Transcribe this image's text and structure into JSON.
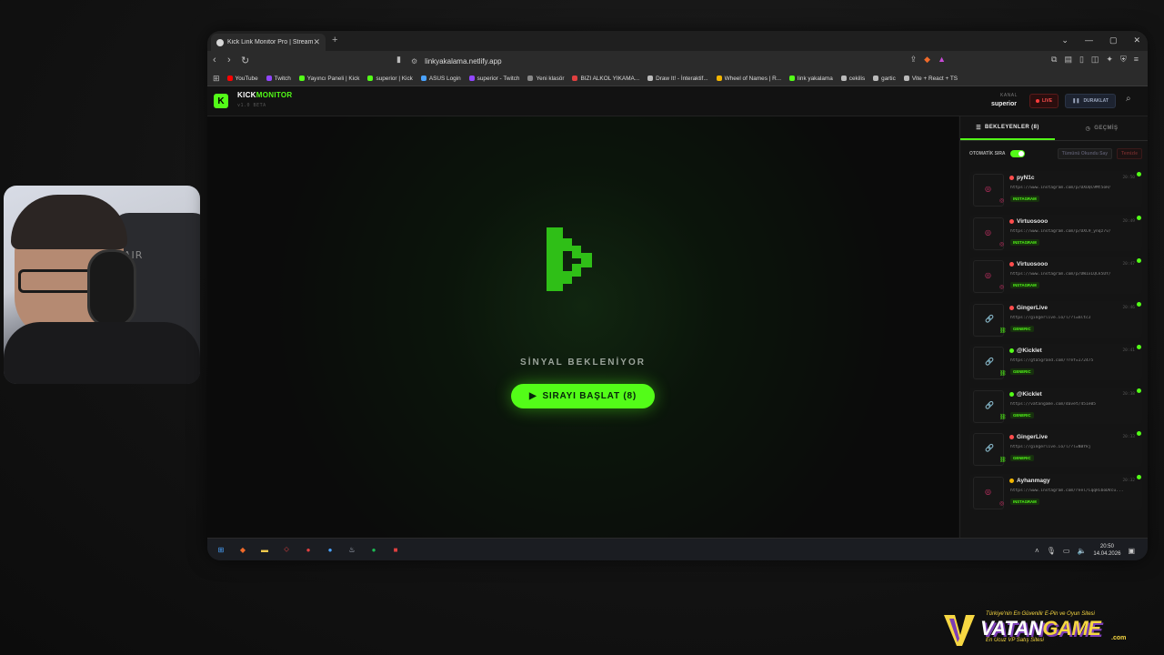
{
  "browser": {
    "tab_title": "Kick Link Monitor Pro | Stream D",
    "url": "linkyakalama.netlify.app",
    "bookmarks": [
      {
        "label": "YouTube",
        "color": "#ff0000"
      },
      {
        "label": "Twitch",
        "color": "#9146ff"
      },
      {
        "label": "Yayıncı Paneli | Kick",
        "color": "#53fc18"
      },
      {
        "label": "superior | Kick",
        "color": "#53fc18"
      },
      {
        "label": "ASUS Login",
        "color": "#4aa3ff"
      },
      {
        "label": "superior - Twitch",
        "color": "#9146ff"
      },
      {
        "label": "Yeni klasör",
        "color": "#888888"
      },
      {
        "label": "BIZI ALKOL YIKAMA...",
        "color": "#e04040"
      },
      {
        "label": "Draw It! - İnteraktif...",
        "color": "#bbbbbb"
      },
      {
        "label": "Wheel of Names | R...",
        "color": "#f2b500"
      },
      {
        "label": "link yakalama",
        "color": "#53fc18"
      },
      {
        "label": "cekilis",
        "color": "#bbbbbb"
      },
      {
        "label": "gartic",
        "color": "#bbbbbb"
      },
      {
        "label": "Vite + React + TS",
        "color": "#bbbbbb"
      }
    ]
  },
  "app": {
    "brand_kick": "KICK",
    "brand_monitor": "MONITOR",
    "logo_letter": "K",
    "version": "v1.0 BETA",
    "channel_label": "KANAL",
    "channel_name": "superior",
    "live_label": "LIVE",
    "pause_label": "DURAKLAT",
    "signal_text": "SİNYAL BEKLENİYOR",
    "start_button": "SIRAYI BAŞLAT (8)",
    "accent_color": "#53fc18"
  },
  "sidebar": {
    "tab_waiting": "BEKLEYENLER (8)",
    "tab_history": "GEÇMİŞ",
    "auto_queue_label": "OTOMATİK SIRA",
    "mark_all_read": "Tümünü Okundu Say",
    "clear": "Temizle",
    "items": [
      {
        "name": "pyN1c",
        "time": "20:50",
        "url": "https://www.instagram.com/p/DXOQC9Mt5oH/",
        "tag": "INSTAGRAM",
        "dot": "#ff4d4d",
        "icon": "instagram"
      },
      {
        "name": "Virtuosooo",
        "time": "20:49",
        "url": "https://www.instagram.com/p/DXC9_ynqz7v/",
        "tag": "INSTAGRAM",
        "dot": "#ff4d4d",
        "icon": "instagram"
      },
      {
        "name": "Virtuosooo",
        "time": "20:47",
        "url": "https://www.instagram.com/p/DW1xLQCk5UY/",
        "tag": "INSTAGRAM",
        "dot": "#ff4d4d",
        "icon": "instagram"
      },
      {
        "name": "GingerLive",
        "time": "20:46",
        "url": "https://gingerlive.io/l/?l=mltcJ",
        "tag": "GENERIC",
        "dot": "#ff4d4d",
        "icon": "link"
      },
      {
        "name": "@Kicklet",
        "time": "20:41",
        "url": "https://gta5grand.com/?ref=172475",
        "tag": "GENERIC",
        "dot": "#53fc18",
        "icon": "link"
      },
      {
        "name": "@Kicklet",
        "time": "20:38",
        "url": "https://vatangame.com/davet/451e05",
        "tag": "GENERIC",
        "dot": "#53fc18",
        "icon": "link"
      },
      {
        "name": "GingerLive",
        "time": "20:33",
        "url": "https://gingerlive.io/l/?l=NBYkj",
        "tag": "GENERIC",
        "dot": "#ff4d4d",
        "icon": "link"
      },
      {
        "name": "Ayhanmagy",
        "time": "20:32",
        "url": "https://www.instagram.com/reel/CqqHiboDVcu...",
        "tag": "INSTAGRAM",
        "dot": "#f2b500",
        "icon": "instagram"
      }
    ]
  },
  "taskbar": {
    "time": "20:50",
    "date": "14.04.2026"
  },
  "watermark": {
    "tagline": "Türkiye'nin En Güvenilir E-Pin ve Oyun Sitesi",
    "word_a": "VATAN",
    "word_b": "GAME",
    "com": ".com",
    "sub": "En Ucuz VP Satış Sitesi"
  }
}
